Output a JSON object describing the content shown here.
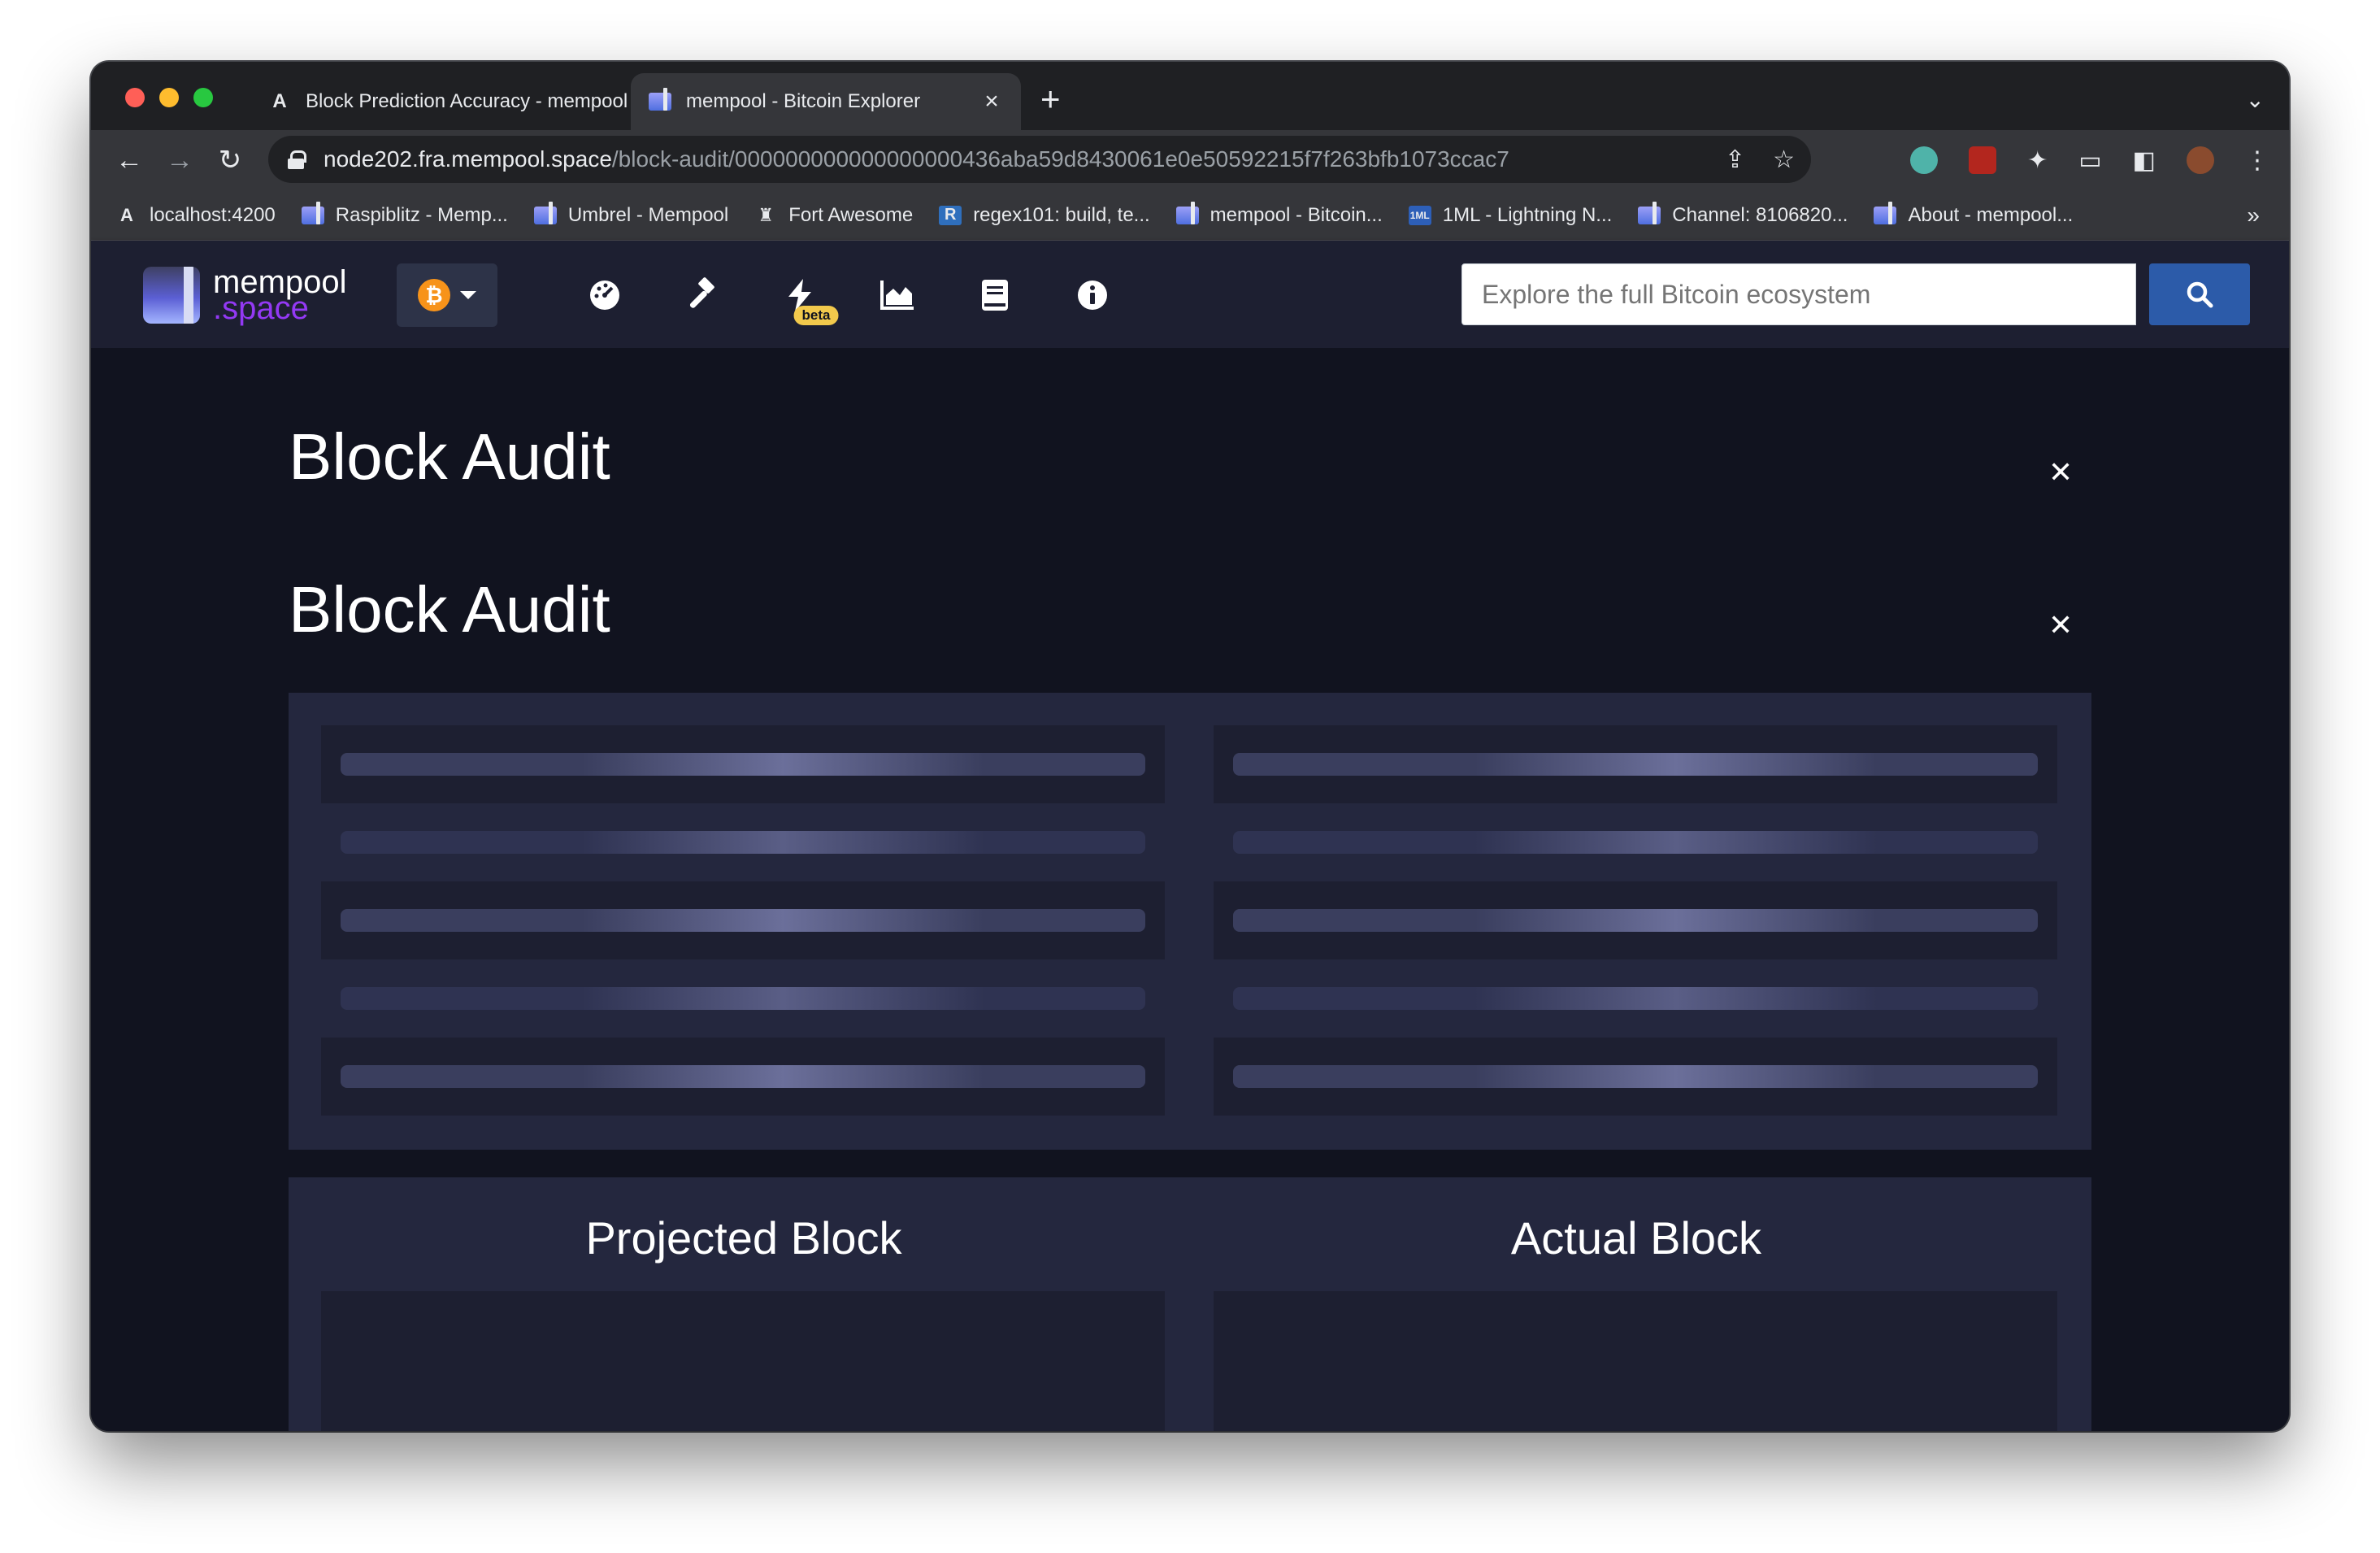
{
  "browser": {
    "tabs": [
      {
        "title": "Block Prediction Accuracy - mempool",
        "icon": "angular-icon",
        "active": false
      },
      {
        "title": "mempool - Bitcoin Explorer",
        "icon": "mempool-icon",
        "active": true
      }
    ],
    "url_host": "node202.fra.mempool.space",
    "url_path": "/block-audit/000000000000000000436aba59d8430061e0e50592215f7f263bfb1073ccac7",
    "bookmarks": [
      {
        "label": "localhost:4200",
        "icon": "angular-icon"
      },
      {
        "label": "Raspiblitz - Memp...",
        "icon": "mempool-icon"
      },
      {
        "label": "Umbrel - Mempool",
        "icon": "mempool-icon"
      },
      {
        "label": "Fort Awesome",
        "icon": "castle-icon"
      },
      {
        "label": "regex101: build, te...",
        "icon": "regex-icon"
      },
      {
        "label": "mempool - Bitcoin...",
        "icon": "mempool-icon"
      },
      {
        "label": "1ML - Lightning N...",
        "icon": "1ml-icon"
      },
      {
        "label": "Channel: 8106820...",
        "icon": "mempool-icon"
      },
      {
        "label": "About - mempool...",
        "icon": "mempool-icon"
      }
    ],
    "bookmarks_more": "»"
  },
  "header": {
    "logo_line1": "mempool",
    "logo_line2": ".space",
    "network_symbol": "₿",
    "nav_badge": "beta",
    "search_placeholder": "Explore the full Bitcoin ecosystem"
  },
  "main": {
    "heading1": "Block Audit",
    "heading2": "Block Audit",
    "projected_title": "Projected Block",
    "actual_title": "Actual Block"
  },
  "colors": {
    "background": "#11131f",
    "header": "#1d1f31",
    "panel": "#24273e",
    "search_button": "#2c5ba9",
    "bitcoin": "#f7931a",
    "space_purple": "#9339f4",
    "beta_badge": "#f2c94c"
  }
}
